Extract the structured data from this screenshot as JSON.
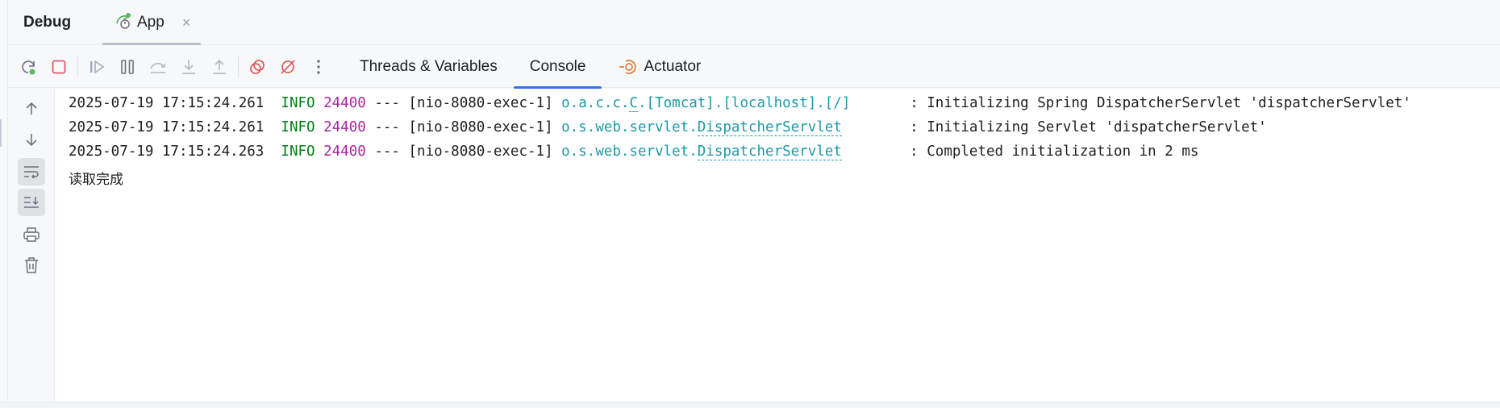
{
  "window": {
    "title": "Debug",
    "tabs": [
      {
        "label": "App",
        "icon": "spring-run-icon",
        "close_label": "×",
        "active": true
      }
    ]
  },
  "toolbar": {
    "buttons": [
      {
        "name": "rerun",
        "icon": "rerun-icon"
      },
      {
        "name": "stop",
        "icon": "stop-icon"
      },
      {
        "name": "resume",
        "icon": "resume-icon"
      },
      {
        "name": "pause",
        "icon": "pause-icon"
      },
      {
        "name": "step-over",
        "icon": "step-over-icon"
      },
      {
        "name": "step-into",
        "icon": "step-into-icon"
      },
      {
        "name": "step-out",
        "icon": "step-out-icon"
      },
      {
        "name": "view-breakpoints",
        "icon": "view-breakpoints-icon"
      },
      {
        "name": "mute-breakpoints",
        "icon": "mute-breakpoints-icon"
      },
      {
        "name": "more",
        "icon": "more-vertical-icon"
      }
    ],
    "view_tabs": [
      {
        "label": "Threads & Variables",
        "active": false
      },
      {
        "label": "Console",
        "active": true
      },
      {
        "label": "Actuator",
        "active": false,
        "icon": "actuator-icon"
      }
    ]
  },
  "gutter": {
    "buttons": [
      {
        "name": "scroll-up",
        "icon": "arrow-up-icon"
      },
      {
        "name": "scroll-down",
        "icon": "arrow-down-icon"
      },
      {
        "name": "soft-wrap",
        "icon": "soft-wrap-icon",
        "toggled": true
      },
      {
        "name": "scroll-to-end",
        "icon": "scroll-to-end-icon",
        "toggled": true
      },
      {
        "name": "print",
        "icon": "print-icon"
      },
      {
        "name": "clear-all",
        "icon": "trash-icon"
      }
    ]
  },
  "console": {
    "lines": [
      {
        "timestamp": "2025-07-19 17:15:24.261",
        "level": "INFO",
        "pid": "24400",
        "sep": "---",
        "thread": "[nio-8080-exec-1]",
        "logger_prefix": "o.a.c.c.",
        "logger_link": "C",
        "logger_suffix": ".[Tomcat].[localhost].[/]",
        "message": ": Initializing Spring DispatcherServlet 'dispatcherServlet'"
      },
      {
        "timestamp": "2025-07-19 17:15:24.261",
        "level": "INFO",
        "pid": "24400",
        "sep": "---",
        "thread": "[nio-8080-exec-1]",
        "logger_prefix": "o.s.web.servlet.",
        "logger_link": "DispatcherServlet",
        "logger_suffix": "",
        "message": ": Initializing Servlet 'dispatcherServlet'"
      },
      {
        "timestamp": "2025-07-19 17:15:24.263",
        "level": "INFO",
        "pid": "24400",
        "sep": "---",
        "thread": "[nio-8080-exec-1]",
        "logger_prefix": "o.s.web.servlet.",
        "logger_link": "DispatcherServlet",
        "logger_suffix": "",
        "message": ": Completed initialization in 2 ms"
      }
    ],
    "stdout_line": "读取完成"
  },
  "colors": {
    "accent": "#3574f0",
    "info": "#067d17",
    "pid": "#a626a4",
    "logger": "#1b9aa8",
    "stop": "#e55765",
    "breakpoint": "#db5c5c",
    "actuator": "#e07b39"
  }
}
